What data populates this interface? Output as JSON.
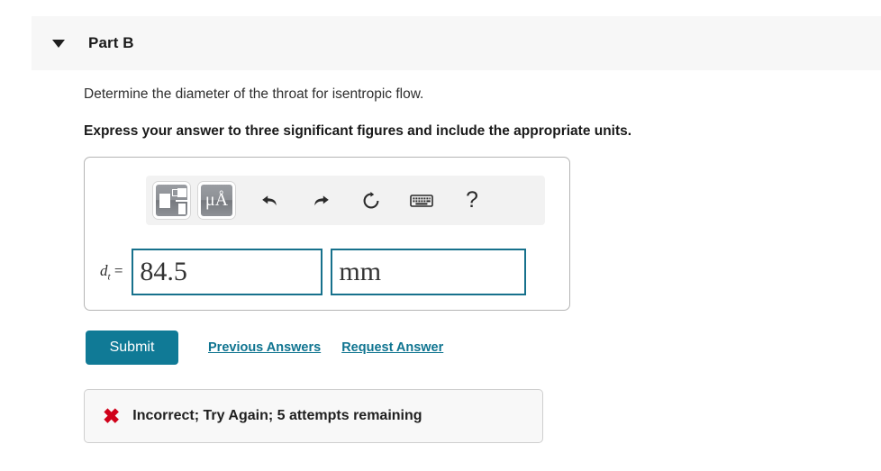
{
  "part": {
    "title": "Part B",
    "disclosure_icon": "triangle-down-icon",
    "expanded": true
  },
  "question": {
    "prompt": "Determine the diameter of the throat for isentropic flow.",
    "instruction": "Express your answer to three significant figures and include the appropriate units."
  },
  "answer_panel": {
    "toolbar": {
      "template_button": {
        "icon": "math-template-icon",
        "label": ""
      },
      "units_button": {
        "icon": "units-icon",
        "label": "μÅ"
      },
      "undo": {
        "icon": "undo-arrow-icon",
        "glyph": "↶"
      },
      "redo": {
        "icon": "redo-arrow-icon",
        "glyph": "↷"
      },
      "reset": {
        "icon": "reset-circular-arrow-icon",
        "glyph": "↻"
      },
      "keyboard": {
        "icon": "keyboard-icon"
      },
      "help": {
        "icon": "help-question-icon",
        "glyph": "?"
      }
    },
    "variable_label": {
      "symbol": "d",
      "subscript": "t",
      "equals": "="
    },
    "value_field": {
      "value": "84.5",
      "placeholder": ""
    },
    "units_field": {
      "value": "mm",
      "placeholder": ""
    }
  },
  "actions": {
    "submit_label": "Submit",
    "previous_answers_label": "Previous Answers",
    "request_answer_label": "Request Answer"
  },
  "feedback": {
    "icon": "red-x-icon",
    "icon_glyph": "✖",
    "message": "Incorrect; Try Again; 5 attempts remaining"
  },
  "colors": {
    "accent_teal": "#107a96",
    "link_teal": "#0f7490",
    "field_border": "#17718c",
    "error_red": "#d0021b",
    "header_bg": "#f7f7f7",
    "toolbar_bg": "#f2f2f2",
    "feedback_bg": "#f8f8f8"
  }
}
